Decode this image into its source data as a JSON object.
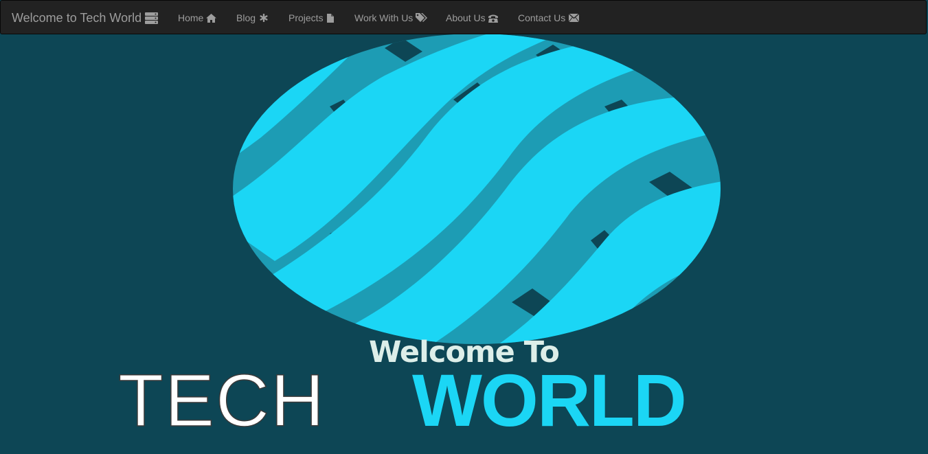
{
  "navbar": {
    "brand": "Welcome to Tech World",
    "brand_icon": "server-icon",
    "items": [
      {
        "label": "Home",
        "icon": "home-icon"
      },
      {
        "label": "Blog",
        "icon": "asterisk-icon"
      },
      {
        "label": "Projects",
        "icon": "file-icon"
      },
      {
        "label": "Work With Us",
        "icon": "tags-icon"
      },
      {
        "label": "About Us",
        "icon": "phone-alt-icon"
      },
      {
        "label": "Contact Us",
        "icon": "envelope-icon"
      }
    ]
  },
  "hero": {
    "heading": "Welcome To",
    "logo": {
      "word1": "TECH",
      "word2": "WORLD"
    }
  },
  "colors": {
    "navbar_bg": "#222222",
    "hero_bg": "#0d4655",
    "globe": "#1bd6f5",
    "globe_shade": "#1d9cb4",
    "heading": "#ddeee9"
  }
}
